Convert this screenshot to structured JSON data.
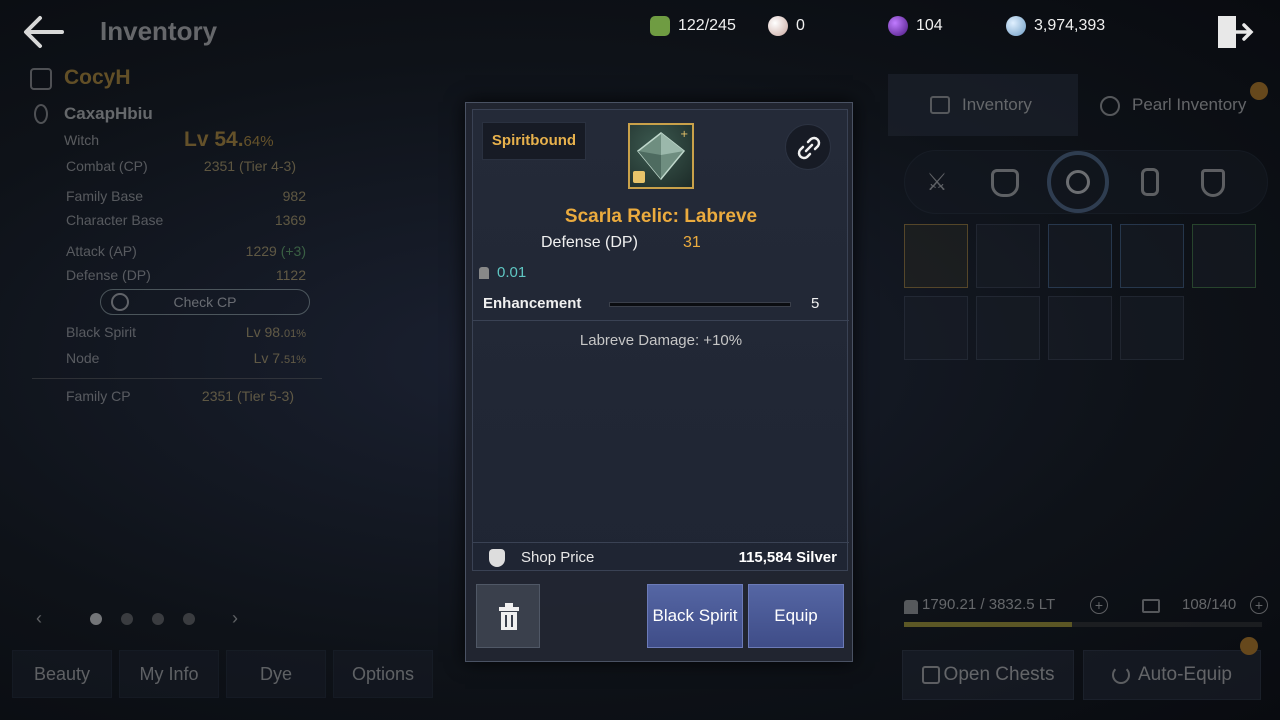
{
  "header": {
    "title": "Inventory"
  },
  "currencies": [
    {
      "name": "stamina",
      "value": "122/245",
      "icon": "leaf-gem-icon",
      "color": "#7fb04a"
    },
    {
      "name": "pearls",
      "value": "0",
      "icon": "pearl-icon",
      "color": "#e0c8c0"
    },
    {
      "name": "black-stone",
      "value": "104",
      "icon": "purple-orb-icon",
      "color": "#8a3fd0"
    },
    {
      "name": "silver",
      "value": "3,974,393",
      "icon": "silver-coin-icon",
      "color": "#9fc6e6"
    }
  ],
  "character": {
    "family_name": "CocyH",
    "char_name": "CaxapHbiu",
    "class": "Witch",
    "level": "Lv 54.",
    "level_pct": "64%",
    "stats": [
      {
        "label": "Combat (CP)",
        "value": "2351 (Tier 4-3)"
      },
      {
        "label": "Family Base",
        "value": "982"
      },
      {
        "label": "Character Base",
        "value": "1369"
      },
      {
        "label": "Attack (AP)",
        "value": "1229",
        "extra": "(+3)"
      },
      {
        "label": "Defense (DP)",
        "value": "1122"
      }
    ],
    "check_cp": "Check CP",
    "black_spirit": {
      "label": "Black Spirit",
      "value": "Lv 98.",
      "pct": "01%"
    },
    "node": {
      "label": "Node",
      "value": "Lv 7.",
      "pct": "51%"
    },
    "family_cp": {
      "label": "Family CP",
      "value": "2351 (Tier 5-3)"
    }
  },
  "bottom_tabs": [
    "Beauty",
    "My Info",
    "Dye",
    "Options"
  ],
  "inventory": {
    "tabs": [
      "Inventory",
      "Pearl Inventory"
    ],
    "categories": [
      "swords-icon",
      "armor-icon",
      "ring-icon",
      "gem-icon",
      "potion-icon"
    ],
    "weight": "1790.21 / 3832.5 LT",
    "weight_fill": 0.47,
    "slots": "108/140",
    "open_chests": "Open Chests",
    "auto_equip": "Auto-Equip"
  },
  "tooltip": {
    "bound": "Spiritbound",
    "item_name": "Scarla Relic: Labreve",
    "stat_label": "Defense (DP)",
    "stat_value": "31",
    "weight": "0.01",
    "enhancement_label": "Enhancement",
    "enhancement_value": "5",
    "effect": "Labreve Damage: +10%",
    "shop_price_label": "Shop Price",
    "shop_price_value": "115,584 Silver",
    "buttons": {
      "black_spirit": "Black Spirit",
      "equip": "Equip"
    }
  }
}
